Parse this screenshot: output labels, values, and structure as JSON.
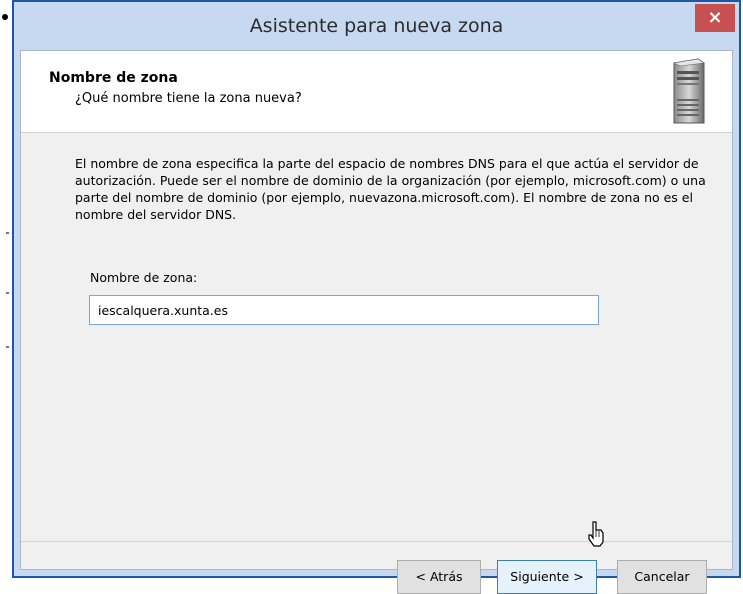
{
  "window": {
    "title": "Asistente para nueva zona",
    "close_label": "×"
  },
  "header": {
    "title": "Nombre de zona",
    "subtitle": "¿Qué nombre tiene la zona  nueva?",
    "icon": "server-icon"
  },
  "body": {
    "description": "El nombre de zona especifica la parte del espacio de nombres DNS para el que actúa el servidor de autorización. Puede ser el nombre de dominio de la organización (por ejemplo, microsoft.com) o una parte del nombre de dominio (por ejemplo, nuevazona.microsoft.com). El nombre de zona no es el nombre del servidor DNS.",
    "zone_label": "Nombre de zona:",
    "zone_value": "iescalquera.xunta.es"
  },
  "buttons": {
    "back": "< Atrás",
    "next": "Siguiente >",
    "cancel": "Cancelar"
  },
  "colors": {
    "title_bar": "#c6d9f1",
    "close_button": "#c75050",
    "input_border": "#7aa7d8"
  }
}
